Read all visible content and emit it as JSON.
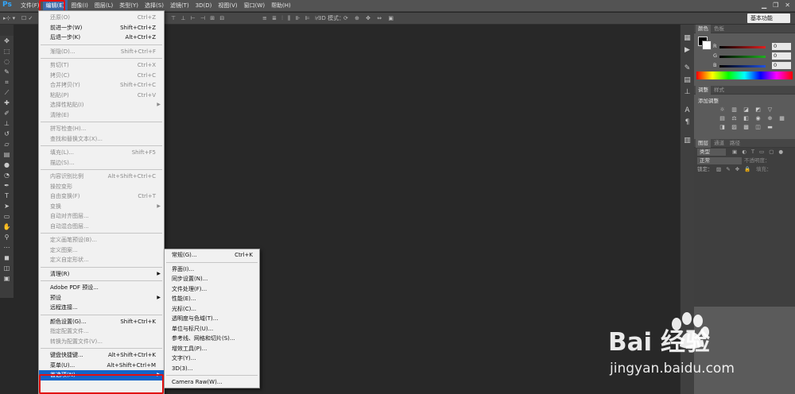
{
  "menubar": {
    "logo": "Ps",
    "items": [
      "文件(F)",
      "编辑(E)",
      "图像(I)",
      "图层(L)",
      "类型(Y)",
      "选择(S)",
      "滤镜(T)",
      "3D(D)",
      "视图(V)",
      "窗口(W)",
      "帮助(H)"
    ],
    "active_index": 1
  },
  "options_bar": {
    "mode_3d_label": "3D 模式：",
    "workspace": "基本功能"
  },
  "edit_menu": [
    {
      "label": "还原(O)",
      "shortcut": "Ctrl+Z",
      "disabled": true
    },
    {
      "label": "前进一步(W)",
      "shortcut": "Shift+Ctrl+Z",
      "disabled": false
    },
    {
      "label": "后退一步(K)",
      "shortcut": "Alt+Ctrl+Z",
      "disabled": false
    },
    {
      "sep": true
    },
    {
      "label": "渐隐(D)...",
      "shortcut": "Shift+Ctrl+F",
      "disabled": true
    },
    {
      "sep": true
    },
    {
      "label": "剪切(T)",
      "shortcut": "Ctrl+X",
      "disabled": true
    },
    {
      "label": "拷贝(C)",
      "shortcut": "Ctrl+C",
      "disabled": true
    },
    {
      "label": "合并拷贝(Y)",
      "shortcut": "Shift+Ctrl+C",
      "disabled": true
    },
    {
      "label": "粘贴(P)",
      "shortcut": "Ctrl+V",
      "disabled": true
    },
    {
      "label": "选择性粘贴(I)",
      "shortcut": "",
      "disabled": true,
      "submenu": true
    },
    {
      "label": "清除(E)",
      "shortcut": "",
      "disabled": true
    },
    {
      "sep": true
    },
    {
      "label": "拼写检查(H)...",
      "shortcut": "",
      "disabled": true
    },
    {
      "label": "查找和替换文本(X)...",
      "shortcut": "",
      "disabled": true
    },
    {
      "sep": true
    },
    {
      "label": "填充(L)...",
      "shortcut": "Shift+F5",
      "disabled": true
    },
    {
      "label": "描边(S)...",
      "shortcut": "",
      "disabled": true
    },
    {
      "sep": true
    },
    {
      "label": "内容识别比例",
      "shortcut": "Alt+Shift+Ctrl+C",
      "disabled": true
    },
    {
      "label": "操控变形",
      "shortcut": "",
      "disabled": true
    },
    {
      "label": "自由变换(F)",
      "shortcut": "Ctrl+T",
      "disabled": true
    },
    {
      "label": "变换",
      "shortcut": "",
      "disabled": true,
      "submenu": true
    },
    {
      "label": "自动对齐图层...",
      "shortcut": "",
      "disabled": true
    },
    {
      "label": "自动混合图层...",
      "shortcut": "",
      "disabled": true
    },
    {
      "sep": true
    },
    {
      "label": "定义画笔预设(B)...",
      "shortcut": "",
      "disabled": true
    },
    {
      "label": "定义图案...",
      "shortcut": "",
      "disabled": true
    },
    {
      "label": "定义自定形状...",
      "shortcut": "",
      "disabled": true
    },
    {
      "sep": true
    },
    {
      "label": "清理(R)",
      "shortcut": "",
      "disabled": false,
      "submenu": true
    },
    {
      "sep": true
    },
    {
      "label": "Adobe PDF 预设...",
      "shortcut": "",
      "disabled": false
    },
    {
      "label": "预设",
      "shortcut": "",
      "disabled": false,
      "submenu": true
    },
    {
      "label": "远程连接...",
      "shortcut": "",
      "disabled": false
    },
    {
      "sep": true
    },
    {
      "label": "颜色设置(G)...",
      "shortcut": "Shift+Ctrl+K",
      "disabled": false
    },
    {
      "label": "指定配置文件...",
      "shortcut": "",
      "disabled": true
    },
    {
      "label": "转换为配置文件(V)...",
      "shortcut": "",
      "disabled": true
    },
    {
      "sep": true
    },
    {
      "label": "键盘快捷键...",
      "shortcut": "Alt+Shift+Ctrl+K",
      "disabled": false
    },
    {
      "label": "菜单(U)...",
      "shortcut": "Alt+Shift+Ctrl+M",
      "disabled": false
    },
    {
      "label": "首选项(N)",
      "shortcut": "",
      "disabled": false,
      "submenu": true,
      "highlight": true
    }
  ],
  "pref_menu": [
    {
      "label": "常规(G)...",
      "shortcut": "Ctrl+K"
    },
    {
      "sep": true
    },
    {
      "label": "界面(I)...",
      "shortcut": ""
    },
    {
      "label": "同步设置(N)...",
      "shortcut": ""
    },
    {
      "label": "文件处理(F)...",
      "shortcut": ""
    },
    {
      "label": "性能(E)...",
      "shortcut": ""
    },
    {
      "label": "光标(C)...",
      "shortcut": ""
    },
    {
      "label": "透明度与色域(T)...",
      "shortcut": ""
    },
    {
      "label": "单位与标尺(U)...",
      "shortcut": ""
    },
    {
      "label": "参考线、网格和切片(S)...",
      "shortcut": ""
    },
    {
      "label": "增效工具(P)...",
      "shortcut": ""
    },
    {
      "label": "文字(Y)...",
      "shortcut": ""
    },
    {
      "label": "3D(3)...",
      "shortcut": ""
    },
    {
      "sep": true
    },
    {
      "label": "Camera Raw(W)...",
      "shortcut": ""
    }
  ],
  "color_panel": {
    "tabs": [
      "颜色",
      "色板"
    ],
    "channels": [
      {
        "label": "R",
        "value": "0",
        "color": "#e02020"
      },
      {
        "label": "G",
        "value": "0",
        "color": "#20b020"
      },
      {
        "label": "B",
        "value": "0",
        "color": "#2050e0"
      }
    ]
  },
  "adjust_panel": {
    "tabs": [
      "调整",
      "样式"
    ],
    "title": "添加调整"
  },
  "layers_panel": {
    "tabs": [
      "图层",
      "通道",
      "路径"
    ],
    "kind": "类型",
    "blend": "正常",
    "opacity_label": "不透明度：",
    "lock_label": "锁定：",
    "fill_label": "填充："
  },
  "watermark": {
    "brand": "Bai  经验",
    "url": "jingyan.baidu.com"
  },
  "colors": {
    "highlight": "#1464c8",
    "annotation": "#e01010"
  }
}
